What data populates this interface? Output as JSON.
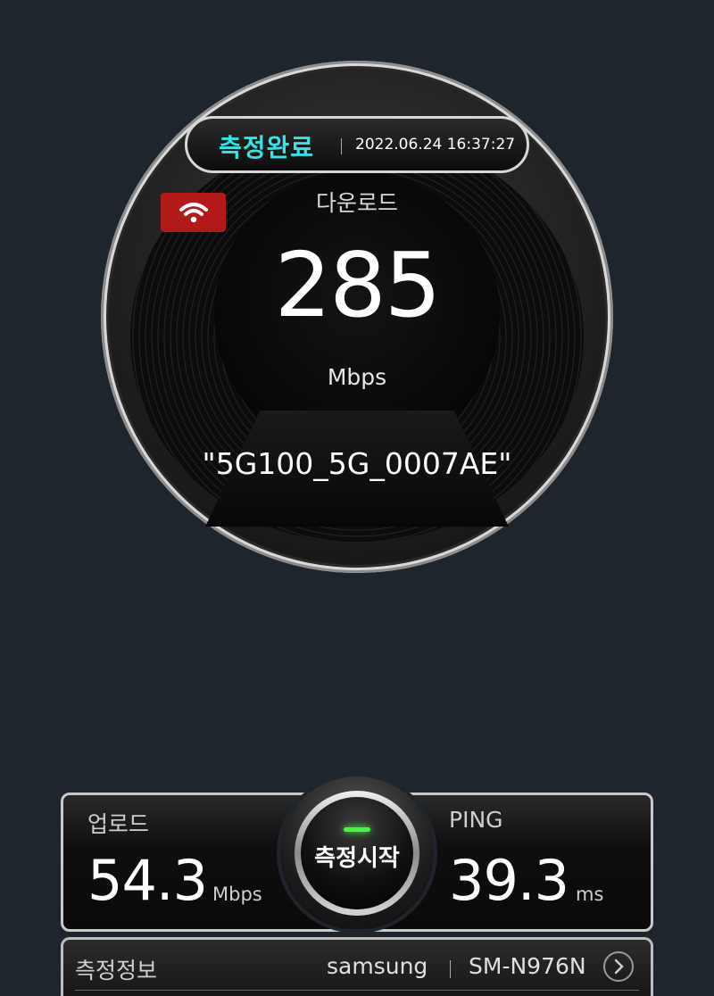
{
  "header": {
    "status": "측정완료",
    "timestamp": "2022.06.24 16:37:27"
  },
  "gauge": {
    "label": "다운로드",
    "value": "285",
    "unit": "Mbps",
    "network_name": "\"5G100_5G_0007AE\"",
    "wifi_badge_icon": "wifi-icon",
    "badge_color": "#b21a1a"
  },
  "results": {
    "upload": {
      "label": "업로드",
      "value": "54.3",
      "unit": "Mbps"
    },
    "ping": {
      "label": "PING",
      "value": "39.3",
      "unit": "ms"
    }
  },
  "start_button": {
    "label": "측정시작",
    "led_color": "#3cff3c"
  },
  "info": {
    "title": "측정정보",
    "manufacturer": "samsung",
    "model": "SM-N976N",
    "chevron_icon": "chevron-right-icon"
  },
  "colors": {
    "accent": "#2ee6e6",
    "background": "#1f252c"
  }
}
